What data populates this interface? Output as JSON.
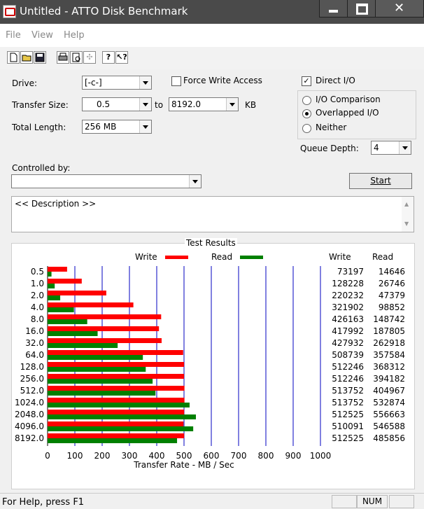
{
  "window": {
    "title": "Untitled - ATTO Disk Benchmark"
  },
  "menu": {
    "items": [
      "File",
      "View",
      "Help"
    ]
  },
  "toolbar": {
    "icons": [
      "new-file-icon",
      "open-folder-icon",
      "save-icon",
      "print-icon",
      "print-preview-icon",
      "move-icon",
      "help-icon",
      "context-help-icon"
    ]
  },
  "form": {
    "drive_label": "Drive:",
    "drive_value": "[-c-]",
    "force_write_label": "Force Write Access",
    "force_write_checked": false,
    "direct_io_label": "Direct I/O",
    "direct_io_checked": true,
    "transfer_size_label": "Transfer Size:",
    "transfer_from": "0.5",
    "to_label": "to",
    "transfer_to": "8192.0",
    "kb_label": "KB",
    "total_length_label": "Total Length:",
    "total_length_value": "256 MB",
    "io_comparison_label": "I/O Comparison",
    "overlapped_io_label": "Overlapped I/O",
    "neither_label": "Neither",
    "selected_mode": "Overlapped I/O",
    "queue_depth_label": "Queue Depth:",
    "queue_depth_value": "4",
    "controlled_by_label": "Controlled by:",
    "controlled_by_value": "",
    "start_label": "Start",
    "description": "<< Description >>"
  },
  "results": {
    "title": "Test Results",
    "write_legend": "Write",
    "read_legend": "Read",
    "write_col": "Write",
    "read_col": "Read",
    "write_color": "#ff0000",
    "read_color": "#008000",
    "grid_color": "#0000c0",
    "xlabel": "Transfer Rate - MB / Sec",
    "x_ticks": [
      "0",
      "100",
      "200",
      "300",
      "400",
      "500",
      "600",
      "700",
      "800",
      "900",
      "1000"
    ],
    "xlim": [
      0,
      1000
    ]
  },
  "chart_data": {
    "type": "bar",
    "orientation": "horizontal",
    "title": "Test Results",
    "xlabel": "Transfer Rate - MB / Sec",
    "xlim": [
      0,
      1000
    ],
    "categories": [
      "0.5",
      "1.0",
      "2.0",
      "4.0",
      "8.0",
      "16.0",
      "32.0",
      "64.0",
      "128.0",
      "256.0",
      "512.0",
      "1024.0",
      "2048.0",
      "4096.0",
      "8192.0"
    ],
    "series": [
      {
        "name": "Write",
        "values": [
          71.5,
          125.2,
          215.1,
          314.4,
          416.2,
          408.2,
          417.9,
          496.8,
          500.2,
          500.2,
          501.7,
          501.7,
          500.5,
          498.1,
          500.5
        ],
        "labels": [
          "73197",
          "128228",
          "220232",
          "321902",
          "426163",
          "417992",
          "427932",
          "508739",
          "512246",
          "512246",
          "513752",
          "513752",
          "512525",
          "510091",
          "512525"
        ]
      },
      {
        "name": "Read",
        "values": [
          14.3,
          26.1,
          46.3,
          96.5,
          145.3,
          183.4,
          256.8,
          349.2,
          359.7,
          384.9,
          395.5,
          520.4,
          543.6,
          533.7,
          474.5
        ],
        "labels": [
          "14646",
          "26746",
          "47379",
          "98852",
          "148742",
          "187805",
          "262918",
          "357584",
          "368312",
          "394182",
          "404967",
          "532874",
          "556663",
          "546588",
          "485856"
        ]
      }
    ]
  },
  "status": {
    "text": "For Help, press F1",
    "num": "NUM"
  }
}
